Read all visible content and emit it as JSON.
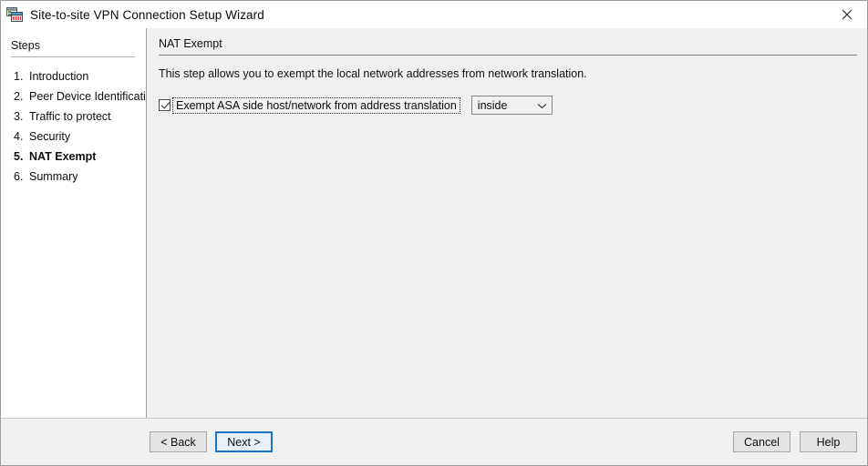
{
  "window": {
    "title": "Site-to-site VPN Connection Setup Wizard",
    "app_icon": "vpn-wizard-icon",
    "close_icon": "close-icon"
  },
  "sidebar": {
    "heading": "Steps",
    "items": [
      {
        "num": "1.",
        "label": "Introduction",
        "current": false
      },
      {
        "num": "2.",
        "label": "Peer Device Identificatio",
        "current": false
      },
      {
        "num": "3.",
        "label": "Traffic to protect",
        "current": false
      },
      {
        "num": "4.",
        "label": "Security",
        "current": false
      },
      {
        "num": "5.",
        "label": "NAT Exempt",
        "current": true
      },
      {
        "num": "6.",
        "label": "Summary",
        "current": false
      }
    ]
  },
  "content": {
    "title": "NAT Exempt",
    "description": "This step allows you to exempt the local network addresses from network translation.",
    "exempt_checkbox": {
      "label": "Exempt ASA side host/network from address translation",
      "checked": true,
      "focused": true
    },
    "interface_select": {
      "value": "inside",
      "chevron_icon": "chevron-down-icon"
    }
  },
  "footer": {
    "back_label": "< Back",
    "next_label": "Next >",
    "cancel_label": "Cancel",
    "help_label": "Help",
    "focused_button": "Next >"
  },
  "colors": {
    "content_background": "#f0f0f0",
    "sidebar_background": "#ffffff",
    "focus_accent": "#1a73c8",
    "border": "#a0a0a0"
  }
}
